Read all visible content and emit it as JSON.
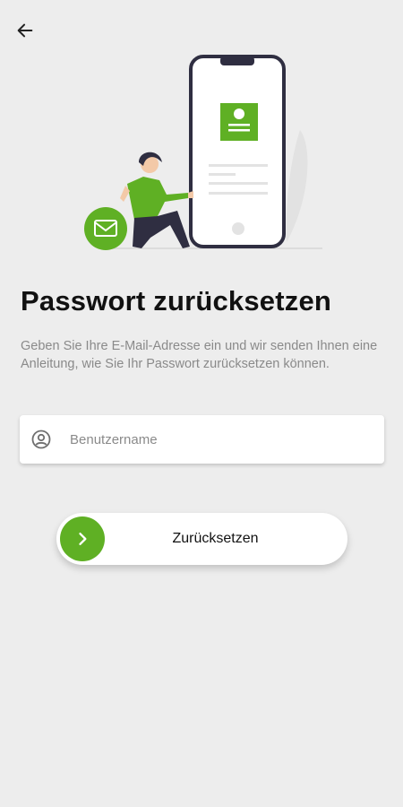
{
  "header": {
    "back_icon": "arrow-left-icon"
  },
  "illustration": {
    "description_icon": "person-with-phone-illustration",
    "accent_color": "#5fb024",
    "mail_icon": "envelope-icon"
  },
  "page": {
    "title": "Passwort zurücksetzen",
    "description": "Geben Sie Ihre E-Mail-Adresse ein und wir senden Ihnen eine Anleitung, wie Sie Ihr Passwort zurücksetzen können."
  },
  "form": {
    "username_placeholder": "Benutzername",
    "username_value": "",
    "username_icon": "user-circle-icon"
  },
  "actions": {
    "reset_label": "Zurücksetzen",
    "reset_icon": "chevron-right-icon"
  },
  "colors": {
    "accent": "#5fb024",
    "background": "#ededed"
  }
}
